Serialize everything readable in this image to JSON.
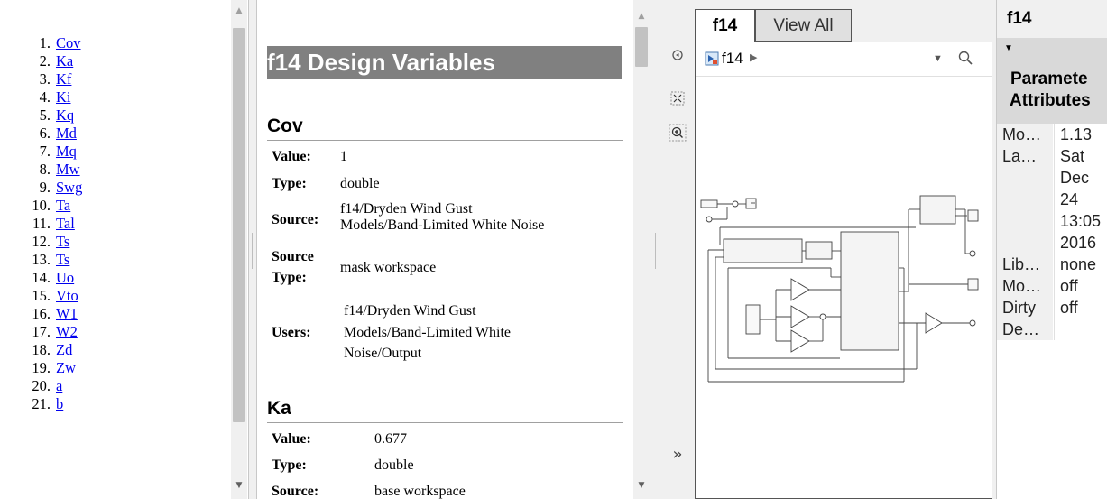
{
  "variables": [
    "Cov",
    "Ka",
    "Kf",
    "Ki",
    "Kq",
    "Md",
    "Mq",
    "Mw",
    "Swg",
    "Ta",
    "Tal",
    "Ts",
    "Ts",
    "Uo",
    "Vto",
    "W1",
    "W2",
    "Zd",
    "Zw",
    "a",
    "b"
  ],
  "numbers": [
    "1.",
    "2.",
    "3.",
    "4.",
    "5.",
    "6.",
    "7.",
    "8.",
    "9.",
    "10.",
    "11.",
    "12.",
    "13.",
    "14.",
    "15.",
    "16.",
    "17.",
    "18.",
    "19.",
    "20.",
    "21."
  ],
  "report": {
    "title": "f14 Design Variables",
    "cov": {
      "heading": "Cov",
      "value_label": "Value:",
      "value": "1",
      "type_label": "Type:",
      "type": "double",
      "source_label": "Source:",
      "source_line1": "f14/Dryden Wind Gust",
      "source_line2": "Models/Band-Limited White Noise",
      "source_type_label1": "Source",
      "source_type_label2": "Type:",
      "source_type": "mask workspace",
      "users_label": "Users:",
      "users_line1": "f14/Dryden Wind Gust",
      "users_line2": "Models/Band-Limited White",
      "users_line3": "Noise/Output"
    },
    "ka": {
      "heading": "Ka",
      "value_label": "Value:",
      "value": "0.677",
      "type_label": "Type:",
      "type": "double",
      "source_label": "Source:",
      "source": "base workspace"
    }
  },
  "model_browser": {
    "tab_active": "f14",
    "tab_other": "View All",
    "breadcrumb": "f14"
  },
  "properties": {
    "header": "f14",
    "group_line1": "Paramete",
    "group_line2": "Attributes",
    "rows": [
      {
        "key": "Mo…",
        "value": "1.13"
      },
      {
        "key": "La…",
        "value": "Sat"
      },
      {
        "key": "",
        "value": "Dec"
      },
      {
        "key": "",
        "value": "24"
      },
      {
        "key": "",
        "value": "13:05"
      },
      {
        "key": "",
        "value": "2016"
      },
      {
        "key": "Lib…",
        "value": "none"
      },
      {
        "key": "Mo…",
        "value": "off"
      },
      {
        "key": "Dirty",
        "value": "off"
      },
      {
        "key": "De…",
        "value": ""
      }
    ]
  },
  "icons": {
    "back": "circle-arrow-icon",
    "fit": "fit-to-view-icon",
    "zoom": "zoom-in-icon",
    "expand": "double-chevron-right-icon",
    "model": "model-icon",
    "search": "search-icon"
  }
}
